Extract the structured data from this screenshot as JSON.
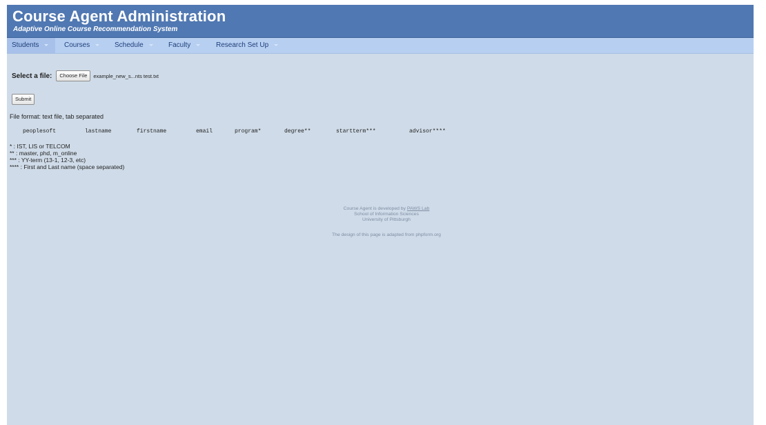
{
  "header": {
    "title": "Course Agent Administration",
    "subtitle": "Adaptive Online Course Recommendation System"
  },
  "nav": {
    "items": [
      {
        "label": "Students"
      },
      {
        "label": "Courses"
      },
      {
        "label": "Schedule"
      },
      {
        "label": "Faculty"
      },
      {
        "label": "Research Set Up"
      }
    ]
  },
  "upload": {
    "label": "Select a file:",
    "choose_button": "Choose File",
    "file_name": "example_new_s...nts test.txt",
    "submit_button": "Submit"
  },
  "format": {
    "text": "File format: text file, tab separated",
    "columns": [
      "peoplesoft",
      "lastname",
      "firstname",
      "email",
      "program*",
      "degree**",
      "startterm***",
      "advisor****"
    ]
  },
  "notes": [
    "* : IST, LIS or TELCOM",
    "** : master, phd, m_online",
    "*** : YY-term (13-1, 12-3, etc)",
    "**** : First and Last name (space separated)"
  ],
  "footer": {
    "line1_prefix": "Course Agent is developed by ",
    "line1_link": "PAWS Lab",
    "line2": "School of Information Sciences",
    "line3": "University of Pittsburgh",
    "line4": "The design of this page is adapted from phpform.org"
  },
  "colors": {
    "banner": "#5078b2",
    "nav": "#b7cff1",
    "page_background": "#cfdbe8"
  }
}
